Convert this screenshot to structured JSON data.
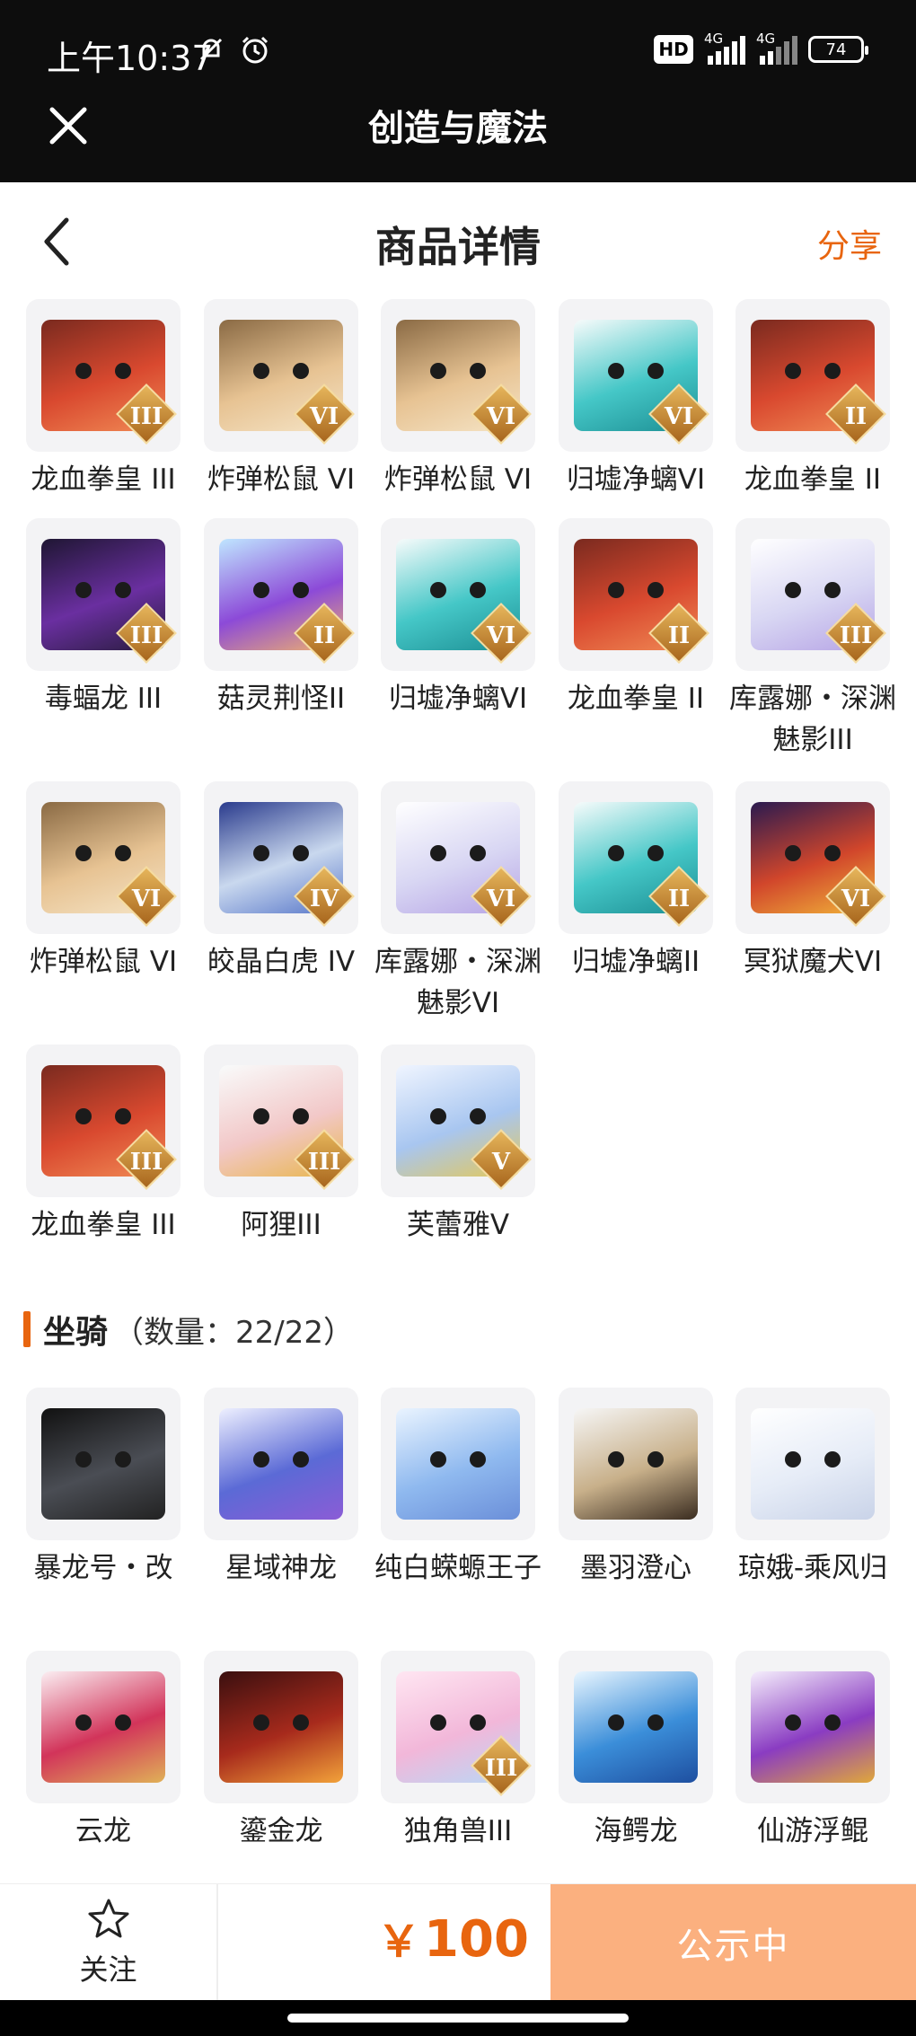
{
  "status_bar": {
    "time": "上午10:37",
    "hd": "HD",
    "net1": "4G",
    "net2": "4G",
    "battery": "74"
  },
  "app": {
    "title": "创造与魔法"
  },
  "header": {
    "title": "商品详情",
    "share": "分享"
  },
  "pets": [
    {
      "name": "龙血拳皇 III",
      "tier": "III",
      "theme": "dragon-red"
    },
    {
      "name": "炸弹松鼠 VI",
      "tier": "VI",
      "theme": "squirrel"
    },
    {
      "name": "炸弹松鼠 VI",
      "tier": "VI",
      "theme": "squirrel"
    },
    {
      "name": "归墟净螭VI",
      "tier": "VI",
      "theme": "cyan-dragon"
    },
    {
      "name": "龙血拳皇 II",
      "tier": "II",
      "theme": "dragon-red"
    },
    {
      "name": "毒蝠龙 III",
      "tier": "III",
      "theme": "dark-dragon"
    },
    {
      "name": "菇灵荆怪II",
      "tier": "II",
      "theme": "mushroom"
    },
    {
      "name": "归墟净螭VI",
      "tier": "VI",
      "theme": "cyan-dragon"
    },
    {
      "name": "龙血拳皇 II",
      "tier": "II",
      "theme": "dragon-red"
    },
    {
      "name": "库露娜・深渊魅影III",
      "tier": "III",
      "theme": "fairy"
    },
    {
      "name": "炸弹松鼠 VI",
      "tier": "VI",
      "theme": "squirrel"
    },
    {
      "name": "皎晶白虎 IV",
      "tier": "IV",
      "theme": "white-tiger"
    },
    {
      "name": "库露娜・深渊魅影VI",
      "tier": "VI",
      "theme": "fairy"
    },
    {
      "name": "归墟净螭II",
      "tier": "II",
      "theme": "cyan-dragon"
    },
    {
      "name": "冥狱魔犬VI",
      "tier": "VI",
      "theme": "hell-dog"
    },
    {
      "name": "龙血拳皇 III",
      "tier": "III",
      "theme": "dragon-red"
    },
    {
      "name": "阿狸III",
      "tier": "III",
      "theme": "ali"
    },
    {
      "name": "芙蕾雅V",
      "tier": "V",
      "theme": "freya"
    }
  ],
  "mounts_section": {
    "title": "坐骑",
    "count": "（数量：22/22）"
  },
  "mounts": [
    {
      "name": "暴龙号・改",
      "tier": "",
      "theme": "mech"
    },
    {
      "name": "星域神龙",
      "tier": "",
      "theme": "star-dragon"
    },
    {
      "name": "纯白蝾螈王子",
      "tier": "",
      "theme": "axolotl"
    },
    {
      "name": "墨羽澄心",
      "tier": "",
      "theme": "feather"
    },
    {
      "name": "琼娥-乘风归",
      "tier": "",
      "theme": "fairy-white"
    },
    {
      "name": "云龙",
      "tier": "",
      "theme": "cloud-dragon"
    },
    {
      "name": "鎏金龙",
      "tier": "",
      "theme": "gold-dragon"
    },
    {
      "name": "独角兽III",
      "tier": "III",
      "theme": "unicorn"
    },
    {
      "name": "海鳄龙",
      "tier": "",
      "theme": "sea-dragon"
    },
    {
      "name": "仙游浮鲲",
      "tier": "",
      "theme": "kun"
    }
  ],
  "bottom_bar": {
    "follow": "关注",
    "currency": "￥",
    "price": "100",
    "status": "公示中"
  },
  "colors": {
    "accent": "#e8650f",
    "status_button": "#fbb07f"
  }
}
